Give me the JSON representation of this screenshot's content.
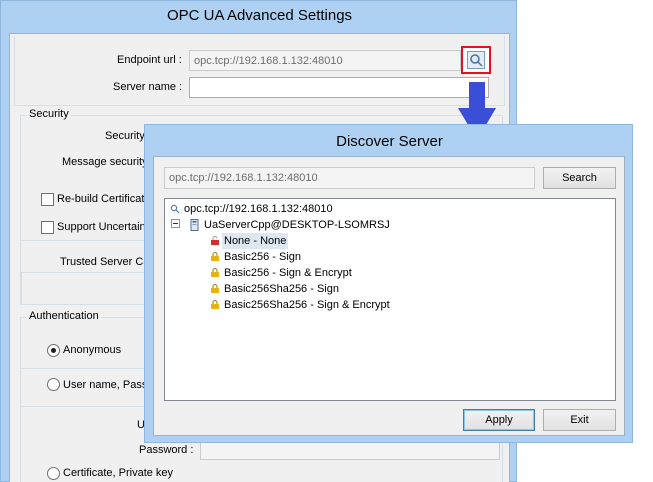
{
  "back_window": {
    "title": "OPC UA Advanced Settings",
    "endpoint_label": "Endpoint url :",
    "endpoint_value": "opc.tcp://192.168.1.132:48010",
    "server_name_label": "Server name :",
    "server_name_value": "",
    "security": {
      "group_title": "Security",
      "security_label": "Security",
      "message_security_label": "Message security",
      "rebuild_certificate_label": "Re-build Certificate",
      "support_uncertain_label": "Support Uncertain",
      "trusted_server_label": "Trusted Server Ce"
    },
    "authentication": {
      "group_title": "Authentication",
      "anonymous_label": "Anonymous",
      "username_label": "User name, Passw",
      "user_label_partial": "U",
      "password_label": "Password :",
      "certificate_label": "Certificate, Private key"
    }
  },
  "discover_window": {
    "title": "Discover Server",
    "url_value": "opc.tcp://192.168.1.132:48010",
    "search_label": "Search",
    "tree": {
      "root": "opc.tcp://192.168.1.132:48010",
      "server": "UaServerCpp@DESKTOP-LSOMRSJ",
      "endpoints": [
        "None - None",
        "Basic256 - Sign",
        "Basic256 - Sign & Encrypt",
        "Basic256Sha256 - Sign",
        "Basic256Sha256 - Sign & Encrypt"
      ]
    },
    "apply_label": "Apply",
    "exit_label": "Exit"
  },
  "colors": {
    "highlight_border": "#e8101e",
    "arrow": "#3a4fd6",
    "window_frame": "#aed1f3"
  }
}
